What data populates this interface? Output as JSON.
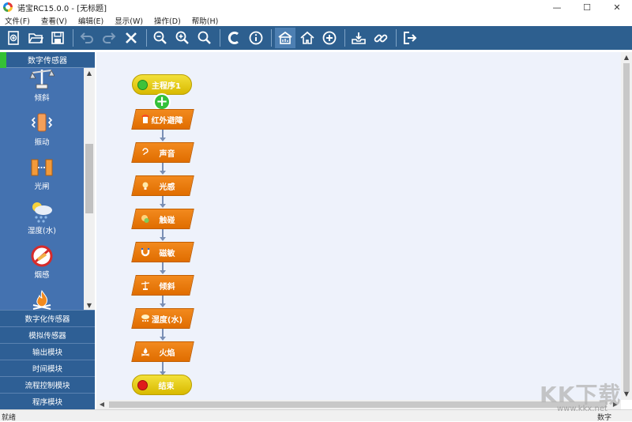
{
  "window": {
    "title": "诺宝RC15.0.0 - [无标题]",
    "controls": [
      "—",
      "☐",
      "✕"
    ]
  },
  "menu": [
    "文件(F)",
    "查看(V)",
    "编辑(E)",
    "显示(W)",
    "操作(D)",
    "帮助(H)"
  ],
  "toolbar": {
    "buttons": [
      "new-icon",
      "open-folder-icon",
      "save-icon",
      "undo-icon",
      "redo-icon",
      "delete-icon",
      "zoom-out-icon",
      "zoom-in-icon",
      "zoom-fit-icon",
      "compile-c-icon",
      "info-icon",
      "home-chart-icon",
      "home-icon",
      "add-circle-icon",
      "download-icon",
      "link-icon",
      "exit-icon"
    ]
  },
  "sidebar": {
    "header": "数字传感器",
    "sensors": [
      {
        "label": "倾斜",
        "icon": "tilt-scale-icon"
      },
      {
        "label": "振动",
        "icon": "vibration-icon"
      },
      {
        "label": "光闸",
        "icon": "light-gate-icon"
      },
      {
        "label": "湿度(水)",
        "icon": "humidity-icon"
      },
      {
        "label": "烟感",
        "icon": "smoke-icon"
      },
      {
        "label": "",
        "icon": "flame-icon"
      }
    ],
    "categories": [
      "数字化传感器",
      "模拟传感器",
      "输出模块",
      "时间模块",
      "流程控制模块",
      "程序模块"
    ]
  },
  "flow": {
    "start": "主程序1",
    "blocks": [
      "红外避障",
      "声音",
      "光感",
      "触碰",
      "磁敏",
      "倾斜",
      "湿度(水)",
      "火焰"
    ],
    "end": "结束"
  },
  "status": {
    "left": "就绪",
    "right": "数字"
  },
  "watermark": {
    "title": "KK下载",
    "url": "www.kkx.net"
  },
  "colors": {
    "toolbar": "#2d5f8f",
    "sidebar": "#2e5f95",
    "sensor_panel": "#4472b0",
    "block_orange": "#f28a1e",
    "start_yellow": "#f3e13a",
    "canvas": "#eef2fb"
  }
}
